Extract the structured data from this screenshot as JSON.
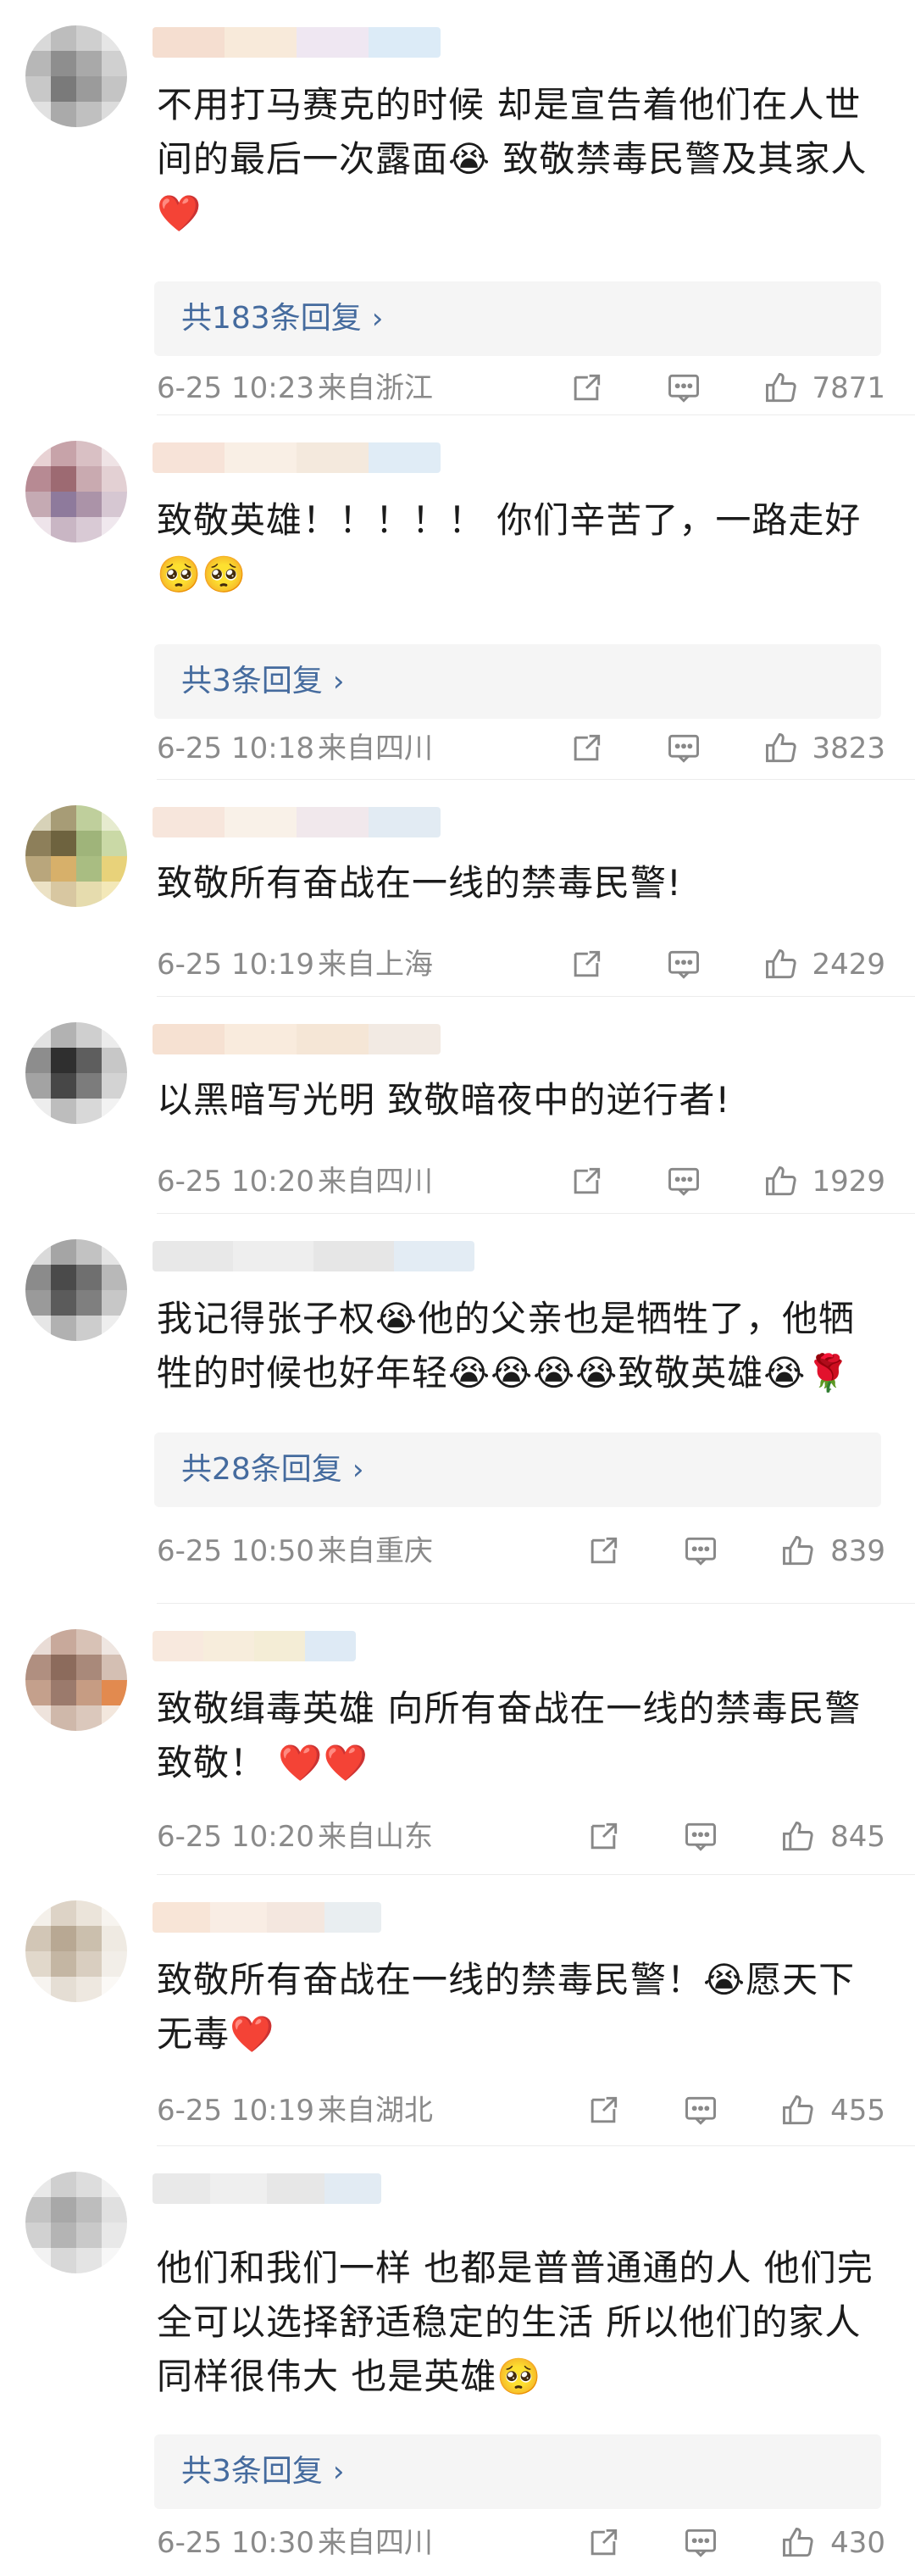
{
  "comments": [
    {
      "text": "不用打马赛克的时候 却是宣告着他们在人世间的最后一次露面😭 致敬禁毒民警及其家人❤️",
      "replies": "共183条回复",
      "time": "6-25 10:23",
      "location": "来自浙江",
      "likes": "7871"
    },
    {
      "text": "致敬英雄！！！！！ 你们辛苦了，一路走好🥺🥺",
      "replies": "共3条回复",
      "time": "6-25 10:18",
      "location": "来自四川",
      "likes": "3823"
    },
    {
      "text": "致敬所有奋战在一线的禁毒民警!",
      "replies": "",
      "time": "6-25 10:19",
      "location": "来自上海",
      "likes": "2429"
    },
    {
      "text": "以黑暗写光明 致敬暗夜中的逆行者!",
      "replies": "",
      "time": "6-25 10:20",
      "location": "来自四川",
      "likes": "1929"
    },
    {
      "text": "我记得张子权😭他的父亲也是牺牲了，他牺牲的时候也好年轻😭😭😭😭致敬英雄😭🌹",
      "replies": "共28条回复",
      "time": "6-25 10:50",
      "location": "来自重庆",
      "likes": "839"
    },
    {
      "text": "致敬缉毒英雄 向所有奋战在一线的禁毒民警致敬！ ❤️❤️",
      "replies": "",
      "time": "6-25 10:20",
      "location": "来自山东",
      "likes": "845"
    },
    {
      "text": "致敬所有奋战在一线的禁毒民警！😭愿天下无毒❤️",
      "replies": "",
      "time": "6-25 10:19",
      "location": "来自湖北",
      "likes": "455"
    },
    {
      "text": "他们和我们一样 也都是普普通通的人 他们完全可以选择舒适稳定的生活 所以他们的家人同样很伟大 也是英雄🥺",
      "replies": "共3条回复",
      "time": "6-25 10:30",
      "location": "来自四川",
      "likes": "430"
    }
  ],
  "icons": {
    "share": "share-icon",
    "comment": "comment-icon",
    "like": "like-icon",
    "chevron": "chevron-right-icon"
  },
  "colors": {
    "reply_link": "#456b9e",
    "meta_text": "#8a8a8a",
    "reply_bg": "#f5f5f5"
  }
}
